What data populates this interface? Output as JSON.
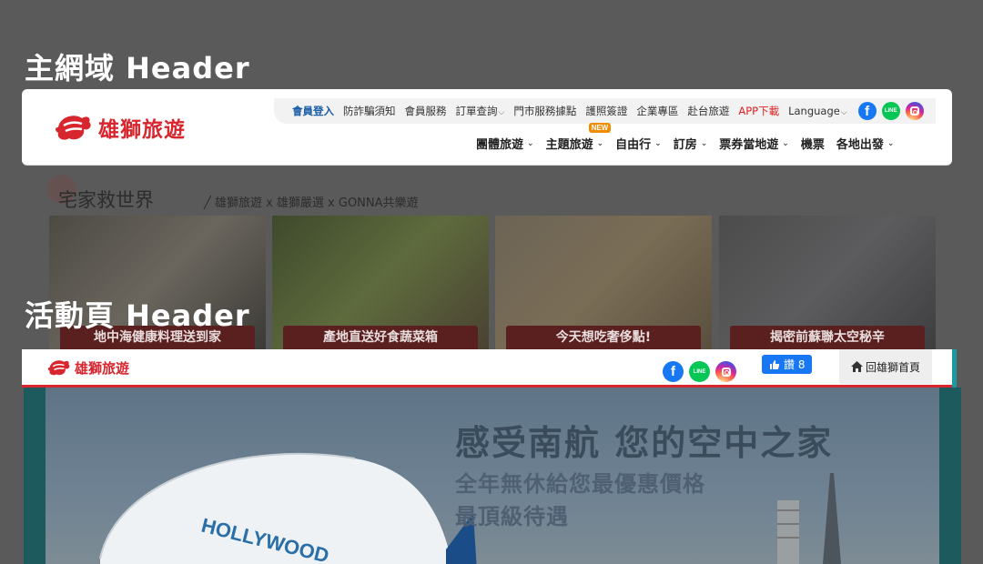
{
  "labels": {
    "main_header": "主網域 Header",
    "event_header": "活動頁 Header"
  },
  "brand": {
    "name": "雄獅旅遊",
    "color": "#d8262f"
  },
  "topbar": {
    "items": [
      "會員登入",
      "防詐騙須知",
      "會員服務",
      "訂單查詢",
      "門市服務據點",
      "護照簽證",
      "企業專區",
      "赴台旅遊",
      "APP下載",
      "Language"
    ],
    "caret": "⌵"
  },
  "mainnav": {
    "items": [
      "團體旅遊",
      "主題旅遊",
      "自由行",
      "訂房",
      "票券當地遊",
      "機票",
      "各地出發"
    ],
    "new_badge": "NEW",
    "chevron": "⌄"
  },
  "promo": {
    "title": "宅家救世界",
    "subtitle": "╱ 雄獅旅遊 x 雄獅嚴選 x GONNA共樂遊",
    "cards": [
      "地中海健康料理送到家",
      "產地直送好食蔬菜箱",
      "今天想吃奢侈點!",
      "揭密前蘇聯太空秘辛"
    ]
  },
  "event_header": {
    "fb_like_label": "讚 8",
    "back_home_label": "回雄獅首頁"
  },
  "banner": {
    "title": "感受南航  您的空中之家",
    "line1": "全年無休給您最優惠價格",
    "line2": "最頂級待遇",
    "plane_text": "HOLLYWOOD"
  },
  "icons": {
    "facebook": "facebook-icon",
    "line": "line-icon",
    "instagram": "instagram-icon",
    "home": "home-icon",
    "thumbs_up": "thumbs-up-icon"
  },
  "colors": {
    "accent_red": "#d8262f",
    "member_blue": "#1a5ea8",
    "facebook": "#1877f2",
    "line": "#06c755",
    "new_badge": "#f08c00"
  }
}
